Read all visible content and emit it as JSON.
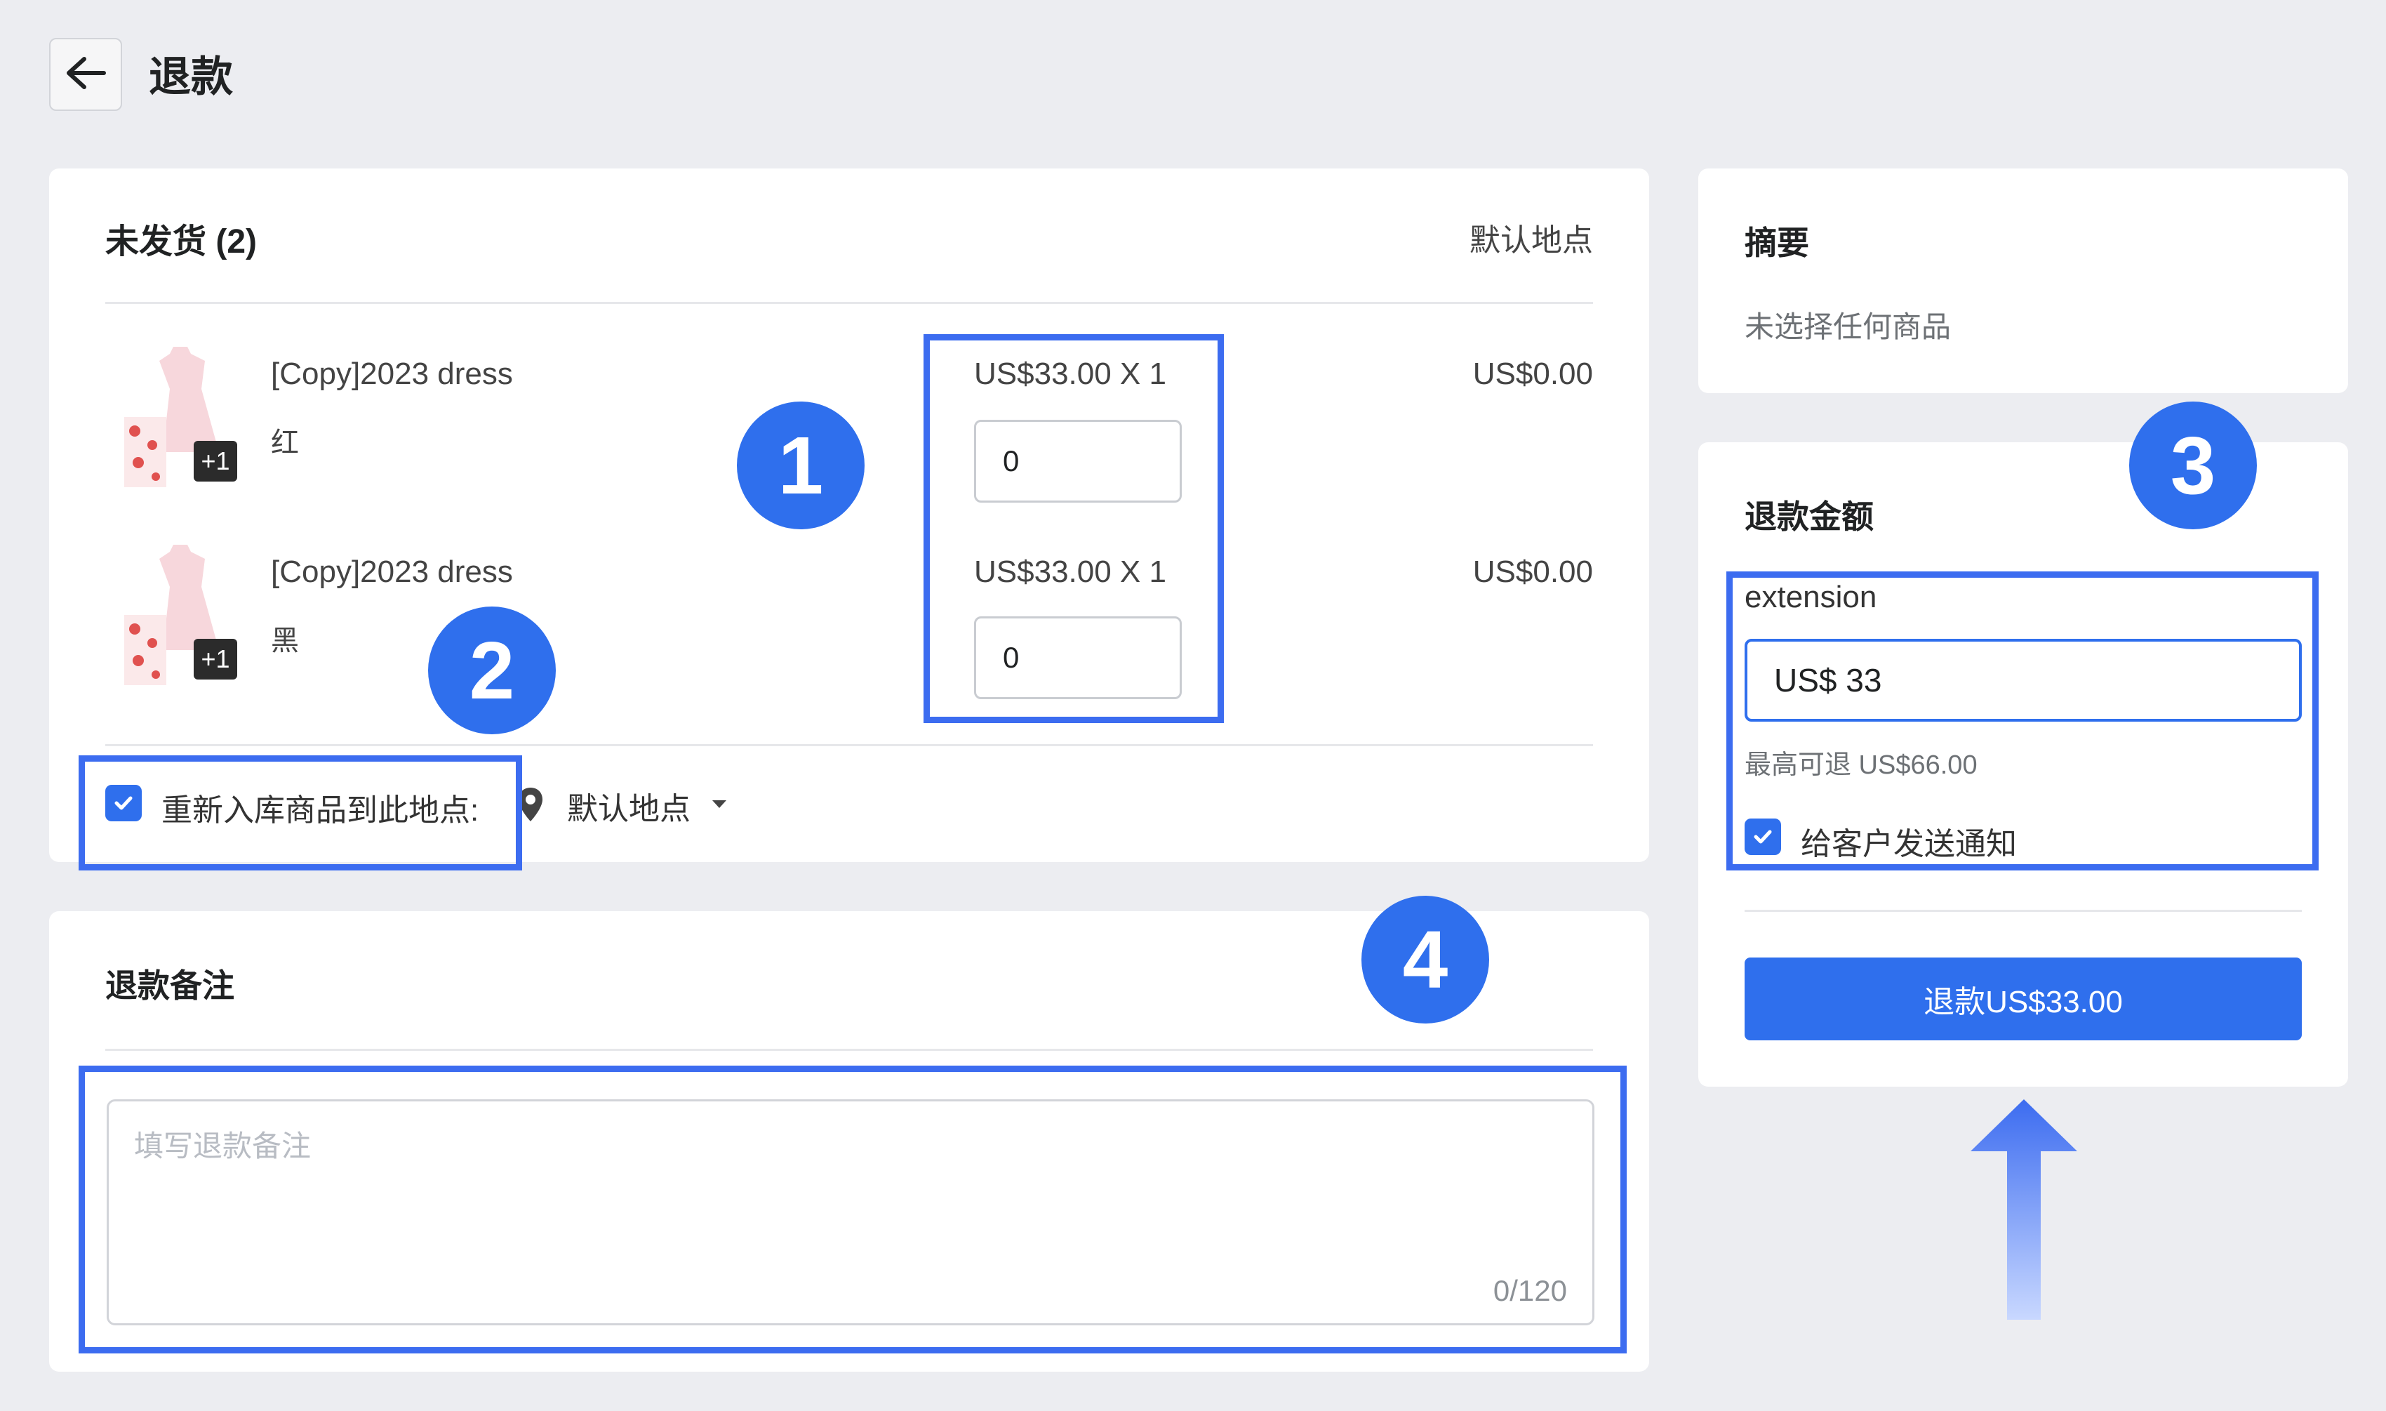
{
  "page": {
    "title": "退款"
  },
  "unfulfilled": {
    "heading": "未发货 (2)",
    "location_label": "默认地点",
    "items": [
      {
        "name": "[Copy]2023 dress",
        "variant": "红",
        "badge": "+1",
        "price": "US$33.00 X 1",
        "qty": "0",
        "total": "US$0.00"
      },
      {
        "name": "[Copy]2023 dress",
        "variant": "黑",
        "badge": "+1",
        "price": "US$33.00 X 1",
        "qty": "0",
        "total": "US$0.00"
      }
    ],
    "restock_label": "重新入库商品到此地点:",
    "restock_location": "默认地点"
  },
  "notes": {
    "heading": "退款备注",
    "placeholder": "填写退款备注",
    "counter": "0/120"
  },
  "summary": {
    "heading": "摘要",
    "empty_text": "未选择任何商品"
  },
  "refund_amount": {
    "heading": "退款金额",
    "gateway_label": "extension",
    "amount": "US$ 33",
    "max_text": "最高可退 US$66.00",
    "notify_label": "给客户发送通知",
    "button_label": "退款US$33.00"
  },
  "markers": [
    "1",
    "2",
    "3",
    "4"
  ],
  "colors": {
    "accent": "#2f6fed",
    "background": "#ecedf1",
    "highlight": "#3c6cf0"
  }
}
